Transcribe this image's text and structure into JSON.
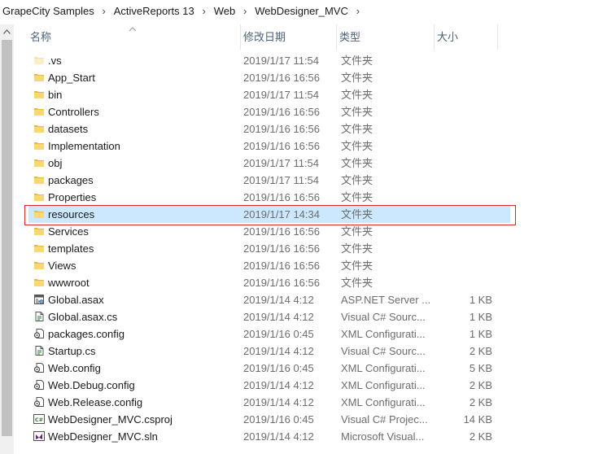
{
  "breadcrumb": [
    "GrapeCity Samples",
    "ActiveReports 13",
    "Web",
    "WebDesigner_MVC"
  ],
  "columns": {
    "name": "名称",
    "date": "修改日期",
    "type": "类型",
    "size": "大小"
  },
  "selected_index": 9,
  "files": [
    {
      "name": ".vs",
      "date": "2019/1/17 11:54",
      "type": "文件夹",
      "size": "",
      "icon": "folder-faint-icon"
    },
    {
      "name": "App_Start",
      "date": "2019/1/16 16:56",
      "type": "文件夹",
      "size": "",
      "icon": "folder-icon"
    },
    {
      "name": "bin",
      "date": "2019/1/17 11:54",
      "type": "文件夹",
      "size": "",
      "icon": "folder-icon"
    },
    {
      "name": "Controllers",
      "date": "2019/1/16 16:56",
      "type": "文件夹",
      "size": "",
      "icon": "folder-icon"
    },
    {
      "name": "datasets",
      "date": "2019/1/16 16:56",
      "type": "文件夹",
      "size": "",
      "icon": "folder-icon"
    },
    {
      "name": "Implementation",
      "date": "2019/1/16 16:56",
      "type": "文件夹",
      "size": "",
      "icon": "folder-icon"
    },
    {
      "name": "obj",
      "date": "2019/1/17 11:54",
      "type": "文件夹",
      "size": "",
      "icon": "folder-icon"
    },
    {
      "name": "packages",
      "date": "2019/1/17 11:54",
      "type": "文件夹",
      "size": "",
      "icon": "folder-icon"
    },
    {
      "name": "Properties",
      "date": "2019/1/16 16:56",
      "type": "文件夹",
      "size": "",
      "icon": "folder-icon"
    },
    {
      "name": "resources",
      "date": "2019/1/17 14:34",
      "type": "文件夹",
      "size": "",
      "icon": "folder-icon"
    },
    {
      "name": "Services",
      "date": "2019/1/16 16:56",
      "type": "文件夹",
      "size": "",
      "icon": "folder-icon"
    },
    {
      "name": "templates",
      "date": "2019/1/16 16:56",
      "type": "文件夹",
      "size": "",
      "icon": "folder-icon"
    },
    {
      "name": "Views",
      "date": "2019/1/16 16:56",
      "type": "文件夹",
      "size": "",
      "icon": "folder-icon"
    },
    {
      "name": "wwwroot",
      "date": "2019/1/16 16:56",
      "type": "文件夹",
      "size": "",
      "icon": "folder-icon"
    },
    {
      "name": "Global.asax",
      "date": "2019/1/14 4:12",
      "type": "ASP.NET Server ...",
      "size": "1 KB",
      "icon": "asax-file-icon"
    },
    {
      "name": "Global.asax.cs",
      "date": "2019/1/14 4:12",
      "type": "Visual C# Sourc...",
      "size": "1 KB",
      "icon": "csharp-file-icon"
    },
    {
      "name": "packages.config",
      "date": "2019/1/16 0:45",
      "type": "XML Configurati...",
      "size": "1 KB",
      "icon": "config-file-icon"
    },
    {
      "name": "Startup.cs",
      "date": "2019/1/14 4:12",
      "type": "Visual C# Sourc...",
      "size": "2 KB",
      "icon": "csharp-file-icon"
    },
    {
      "name": "Web.config",
      "date": "2019/1/16 0:45",
      "type": "XML Configurati...",
      "size": "5 KB",
      "icon": "config-file-icon"
    },
    {
      "name": "Web.Debug.config",
      "date": "2019/1/14 4:12",
      "type": "XML Configurati...",
      "size": "2 KB",
      "icon": "config-file-icon"
    },
    {
      "name": "Web.Release.config",
      "date": "2019/1/14 4:12",
      "type": "XML Configurati...",
      "size": "2 KB",
      "icon": "config-file-icon"
    },
    {
      "name": "WebDesigner_MVC.csproj",
      "date": "2019/1/16 0:45",
      "type": "Visual C# Projec...",
      "size": "14 KB",
      "icon": "csproj-file-icon"
    },
    {
      "name": "WebDesigner_MVC.sln",
      "date": "2019/1/14 4:12",
      "type": "Microsoft Visual...",
      "size": "2 KB",
      "icon": "sln-file-icon"
    }
  ],
  "colors": {
    "folder": "#f8d775",
    "folder_dark": "#e8b84a",
    "selection": "#cce8ff",
    "highlight_border": "#d72a2a",
    "header_text": "#4c607a"
  }
}
